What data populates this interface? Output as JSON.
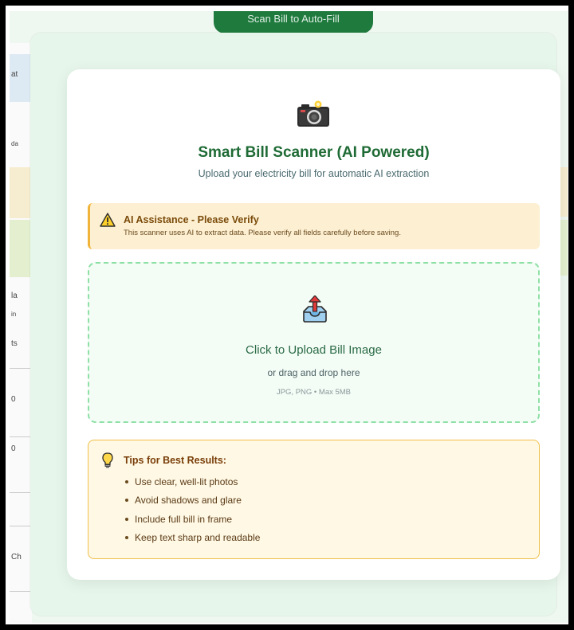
{
  "background": {
    "top_button_label": "Scan Bill to Auto-Fill",
    "fragments": [
      "at",
      "da",
      "la",
      "in",
      "ts",
      "0",
      "0",
      "Ch"
    ]
  },
  "modal": {
    "title": "Smart Bill Scanner (AI Powered)",
    "subtitle": "Upload your electricity bill for automatic AI extraction",
    "alert": {
      "title": "AI Assistance - Please Verify",
      "text": "This scanner uses AI to extract data. Please verify all fields carefully before saving."
    },
    "upload": {
      "title": "Click to Upload Bill Image",
      "subtitle": "or drag and drop here",
      "formats": "JPG, PNG • Max 5MB"
    },
    "tips": {
      "title": "Tips for Best Results:",
      "items": [
        "Use clear, well-lit photos",
        "Avoid shadows and glare",
        "Include full bill in frame",
        "Keep text sharp and readable"
      ]
    }
  },
  "icons": {
    "camera": "camera-icon",
    "warning": "warning-icon",
    "upload": "upload-tray-icon",
    "bulb": "lightbulb-icon"
  },
  "colors": {
    "title_green": "#1f6b35",
    "alert_bg": "#fdf0d2",
    "alert_border": "#f0b43a",
    "dropzone_border": "#8ee0a6",
    "tips_bg": "#fff8e4",
    "tips_border": "#f0c04a"
  }
}
